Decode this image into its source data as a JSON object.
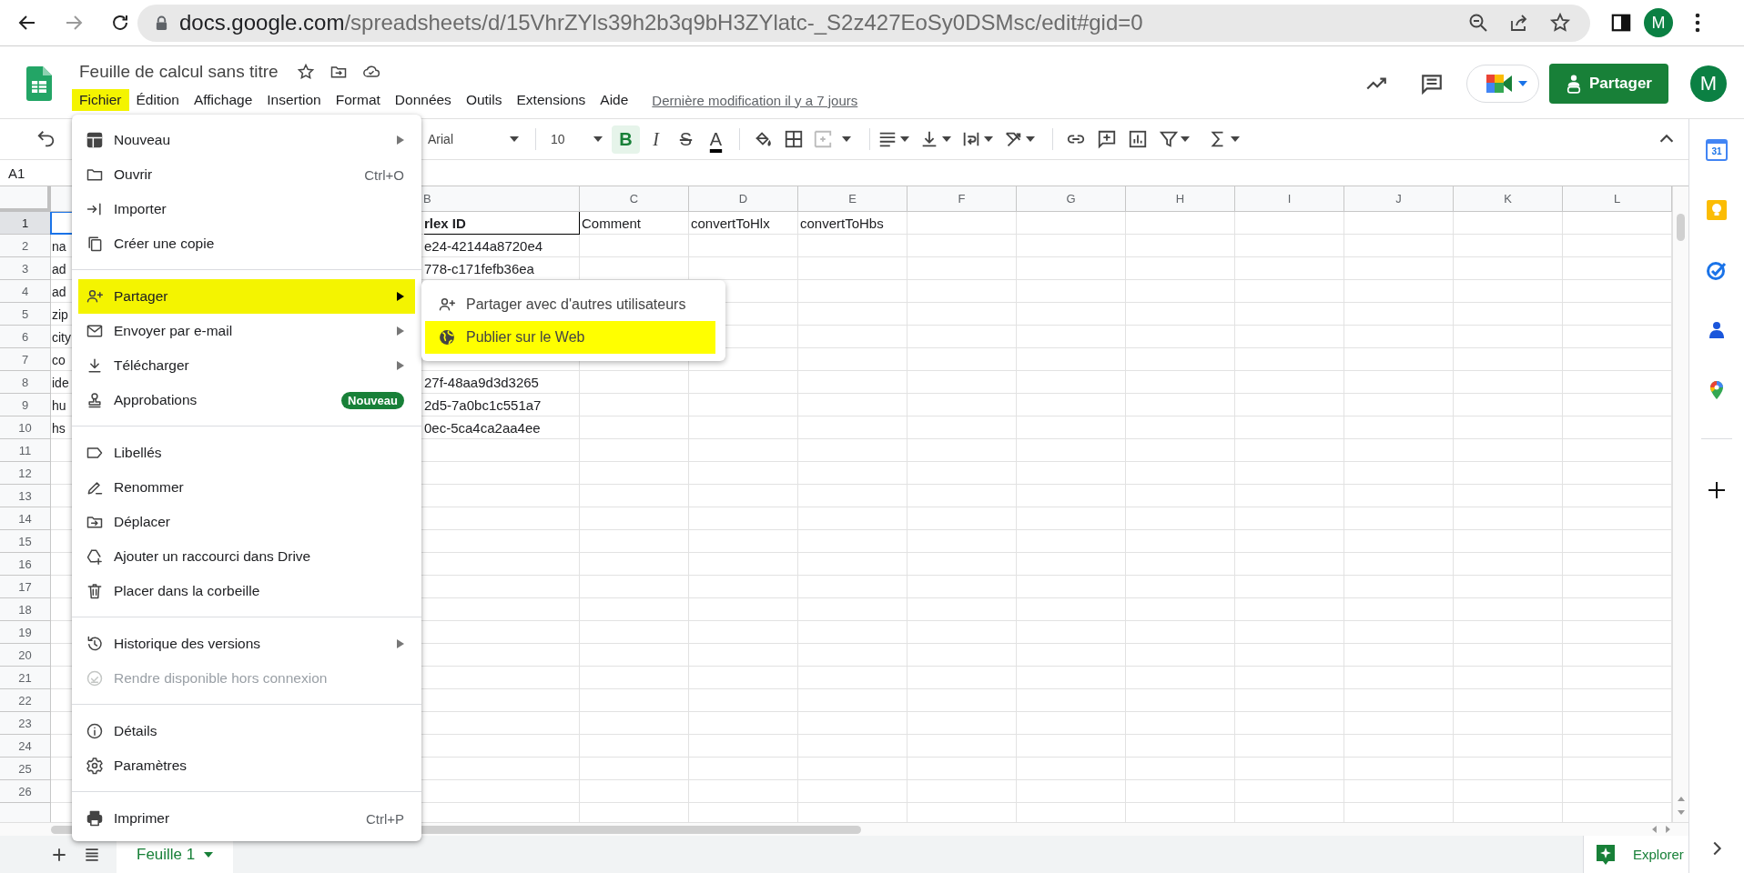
{
  "browser": {
    "url_host": "docs.google.com",
    "url_path": "/spreadsheets/d/15VhrZYls39h2b3q9bH3ZYlatc-_S2z427EoSy0DSMsc/edit#gid=0",
    "avatar": "M"
  },
  "document": {
    "title": "Feuille de calcul sans titre",
    "last_edit": "Dernière modification il y a 7 jours"
  },
  "menubar": [
    {
      "label": "Fichier",
      "selected": true
    },
    {
      "label": "Édition",
      "selected": false
    },
    {
      "label": "Affichage",
      "selected": false
    },
    {
      "label": "Insertion",
      "selected": false
    },
    {
      "label": "Format",
      "selected": false
    },
    {
      "label": "Données",
      "selected": false
    },
    {
      "label": "Outils",
      "selected": false
    },
    {
      "label": "Extensions",
      "selected": false
    },
    {
      "label": "Aide",
      "selected": false
    }
  ],
  "share_button": "Partager",
  "account_avatar": "M",
  "toolbar": {
    "font": "Arial",
    "font_size": "10",
    "format_buttons": [
      {
        "kind": "bold",
        "label": "B",
        "selected": true
      },
      {
        "kind": "italic",
        "label": "I",
        "selected": false
      },
      {
        "kind": "strike",
        "label": "S",
        "selected": false
      },
      {
        "kind": "color",
        "label": "A",
        "selected": false
      }
    ]
  },
  "name_box": "A1",
  "columns": [
    {
      "label": "B"
    },
    {
      "label": "C"
    },
    {
      "label": "D"
    },
    {
      "label": "E"
    },
    {
      "label": "F"
    },
    {
      "label": "G"
    },
    {
      "label": "H"
    },
    {
      "label": "I"
    },
    {
      "label": "J"
    },
    {
      "label": "K"
    },
    {
      "label": "L"
    }
  ],
  "rows": [
    {
      "number": "1",
      "kind": "header",
      "selected": true,
      "b": "rlex ID",
      "c": "Comment",
      "d": "convertToHlx",
      "e": "convertToHbs"
    },
    {
      "number": "2",
      "kind": "data",
      "selected": false,
      "a": "na",
      "b": "e24-42144a8720e4"
    },
    {
      "number": "3",
      "kind": "data",
      "selected": false,
      "a": "ad",
      "b": "778-c171fefb36ea"
    },
    {
      "number": "4",
      "selected": false,
      "a": "ad"
    },
    {
      "number": "5",
      "selected": false,
      "a": "zip"
    },
    {
      "number": "6",
      "selected": false,
      "a": "city"
    },
    {
      "number": "7",
      "selected": false,
      "a": "co"
    },
    {
      "number": "8",
      "kind": "data",
      "selected": false,
      "a": "ide",
      "b": "27f-48aa9d3d3265"
    },
    {
      "number": "9",
      "kind": "data",
      "selected": false,
      "a": "hu",
      "b": "2d5-7a0bc1c551a7"
    },
    {
      "number": "10",
      "kind": "data",
      "selected": false,
      "a": "hs",
      "b": "0ec-5ca4ca2aa4ee"
    },
    {
      "number": "11",
      "selected": false
    },
    {
      "number": "12",
      "selected": false
    },
    {
      "number": "13",
      "selected": false
    },
    {
      "number": "14",
      "selected": false
    },
    {
      "number": "15",
      "selected": false
    },
    {
      "number": "16",
      "selected": false
    },
    {
      "number": "17",
      "selected": false
    },
    {
      "number": "18",
      "selected": false
    },
    {
      "number": "19",
      "selected": false
    },
    {
      "number": "20",
      "selected": false
    },
    {
      "number": "21",
      "selected": false
    },
    {
      "number": "22",
      "selected": false
    },
    {
      "number": "23",
      "selected": false
    },
    {
      "number": "24",
      "selected": false
    },
    {
      "number": "25",
      "selected": false
    },
    {
      "number": "26",
      "selected": false
    }
  ],
  "sheet_tabs": [
    {
      "label": "Feuille 1",
      "selected": true
    }
  ],
  "explore_button": "Explorer",
  "side_panel": {
    "calendar_day": "31"
  },
  "file_menu": {
    "sections": [
      [
        {
          "label": "Nouveau",
          "submenu": true,
          "disabled": false,
          "selected": false
        },
        {
          "label": "Ouvrir",
          "shortcut": "Ctrl+O",
          "submenu": false,
          "disabled": false,
          "selected": false
        },
        {
          "label": "Importer",
          "submenu": false,
          "disabled": false,
          "selected": false
        },
        {
          "label": "Créer une copie",
          "submenu": false,
          "disabled": false,
          "selected": false
        }
      ],
      [
        {
          "label": "Partager",
          "submenu": true,
          "disabled": false,
          "selected": true
        },
        {
          "label": "Envoyer par e-mail",
          "submenu": true,
          "disabled": false,
          "selected": false
        },
        {
          "label": "Télécharger",
          "submenu": true,
          "disabled": false,
          "selected": false
        },
        {
          "label": "Approbations",
          "badge": "Nouveau",
          "submenu": false,
          "disabled": false,
          "selected": false
        }
      ],
      [
        {
          "label": "Libellés",
          "submenu": false,
          "disabled": false,
          "selected": false
        },
        {
          "label": "Renommer",
          "submenu": false,
          "disabled": false,
          "selected": false
        },
        {
          "label": "Déplacer",
          "submenu": false,
          "disabled": false,
          "selected": false
        },
        {
          "label": "Ajouter un raccourci dans Drive",
          "submenu": false,
          "disabled": false,
          "selected": false
        },
        {
          "label": "Placer dans la corbeille",
          "submenu": false,
          "disabled": false,
          "selected": false
        }
      ],
      [
        {
          "label": "Historique des versions",
          "submenu": true,
          "disabled": false,
          "selected": false
        },
        {
          "label": "Rendre disponible hors connexion",
          "submenu": false,
          "disabled": true,
          "selected": false
        }
      ],
      [
        {
          "label": "Détails",
          "submenu": false,
          "disabled": false,
          "selected": false
        },
        {
          "label": "Paramètres",
          "submenu": false,
          "disabled": false,
          "selected": false
        }
      ],
      [
        {
          "label": "Imprimer",
          "shortcut": "Ctrl+P",
          "submenu": false,
          "disabled": false,
          "selected": false
        }
      ]
    ]
  },
  "share_submenu": [
    {
      "label": "Partager avec d'autres utilisateurs",
      "selected": false
    },
    {
      "label": "Publier sur le Web",
      "selected": true
    }
  ]
}
